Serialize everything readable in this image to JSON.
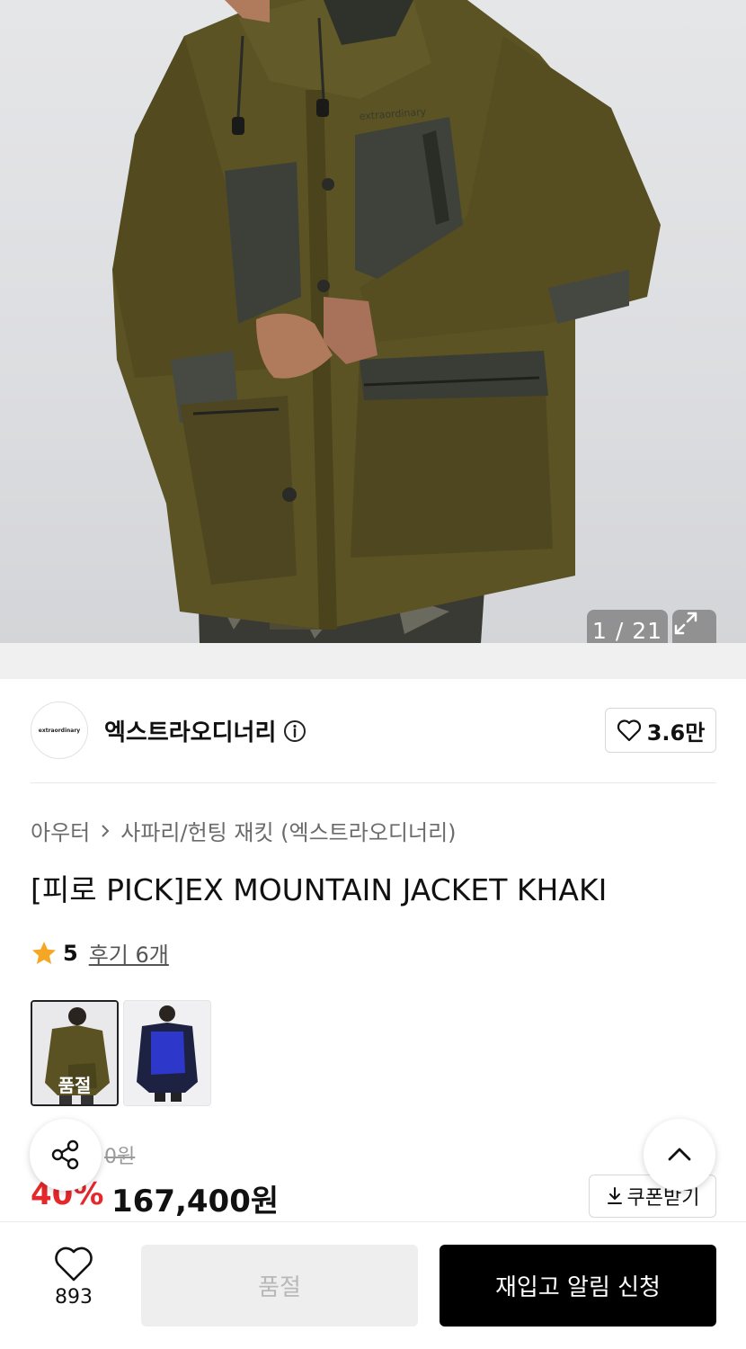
{
  "gallery": {
    "counter": "1 / 21",
    "jacket_logo_text": "extraordinary"
  },
  "brand": {
    "logo_text": "extraordinary",
    "name": "엑스트라오디너리",
    "like_count": "3.6만"
  },
  "breadcrumb": {
    "items": [
      "아우터",
      "사파리/헌팅 재킷 (엑스트라오디너리)"
    ]
  },
  "product": {
    "title": "[피로 PICK]EX MOUNTAIN JACKET KHAKI",
    "rating": "5",
    "reviews_label": "후기 6개"
  },
  "colors": {
    "options": [
      {
        "name": "khaki",
        "tag": "품절",
        "swatch": "#5a5222"
      },
      {
        "name": "blue",
        "swatch": "#2d37c9"
      }
    ]
  },
  "price": {
    "original": "0원",
    "discount": "40%",
    "sale": "167,400원",
    "coupon_label": "쿠폰받기"
  },
  "bottom_bar": {
    "wish_count": "893",
    "soldout_label": "품절",
    "restock_label": "재입고 알림 신청"
  },
  "colors_theme": {
    "discount_red": "#e4282b",
    "star": "#f5a623",
    "primary_btn": "#000000"
  },
  "icons": [
    "expand-icon",
    "info-icon",
    "heart-icon",
    "chevron-right-icon",
    "star-icon",
    "share-icon",
    "chevron-up-icon",
    "download-icon"
  ]
}
